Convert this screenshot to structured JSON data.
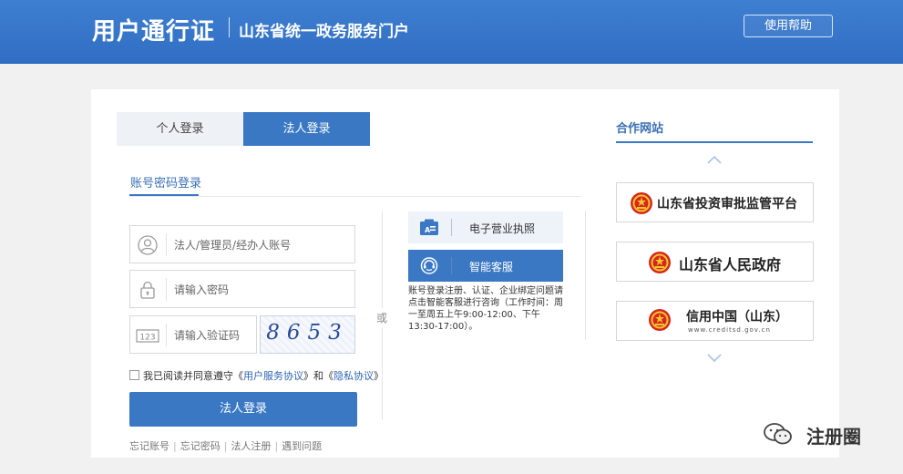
{
  "header": {
    "title": "用户通行证",
    "subtitle": "山东省统一政务服务门户",
    "help_button": "使用帮助"
  },
  "login": {
    "tabs": [
      {
        "label": "个人登录",
        "active": false
      },
      {
        "label": "法人登录",
        "active": true
      }
    ],
    "subtab": "账号密码登录",
    "account_placeholder": "法人/管理员/经办人账号",
    "password_placeholder": "请输入密码",
    "captcha_placeholder": "请输入验证码",
    "captcha_value": "8653",
    "agree_prefix": "我已阅读并同意遵守《",
    "agree_service": "用户服务协议",
    "agree_mid": "》和《",
    "agree_privacy": "隐私协议",
    "agree_suffix": "》",
    "submit": "法人登录",
    "links": [
      "忘记账号",
      "忘记密码",
      "法人注册",
      "遇到问题"
    ],
    "or": "或"
  },
  "services": {
    "license": "电子营业执照",
    "chat": "智能客服",
    "note": "账号登录注册、认证、企业绑定问题请点击智能客服进行咨询（工作时间：周一至周五上午9:00-12:00、下午13:30-17:00）。"
  },
  "partners": {
    "title": "合作网站",
    "sites": [
      {
        "name": "山东省投资审批监管平台"
      },
      {
        "name": "山东省人民政府"
      },
      {
        "name": "信用中国（山东）",
        "url": "www.creditsd.gov.cn"
      }
    ]
  },
  "watermark": {
    "text": "注册圈"
  },
  "colors": {
    "primary": "#3a78c4",
    "header": "#2f6ec2",
    "link": "#2f64b6"
  }
}
